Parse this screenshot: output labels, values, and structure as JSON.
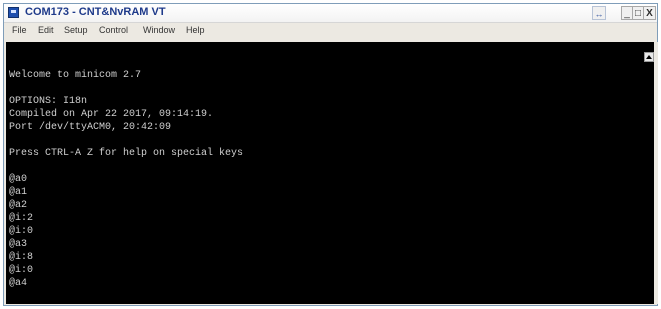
{
  "window": {
    "title": "COM173 - CNT&NvRAM VT",
    "restore_label": "↔",
    "minimize_label": "_",
    "maximize_label": "□",
    "close_label": "X"
  },
  "menu": {
    "items": [
      "File",
      "Edit",
      "Setup",
      "Control",
      "Window",
      "Help"
    ]
  },
  "terminal": {
    "lines": [
      "Welcome to minicom 2.7",
      "",
      "OPTIONS: I18n",
      "Compiled on Apr 22 2017, 09:14:19.",
      "Port /dev/ttyACM0, 20:42:09",
      "",
      "Press CTRL-A Z for help on special keys",
      "",
      "@a0",
      "@a1",
      "@a2",
      "@i:2",
      "@i:0",
      "@a3",
      "@i:8",
      "@i:0",
      "@a4"
    ]
  }
}
